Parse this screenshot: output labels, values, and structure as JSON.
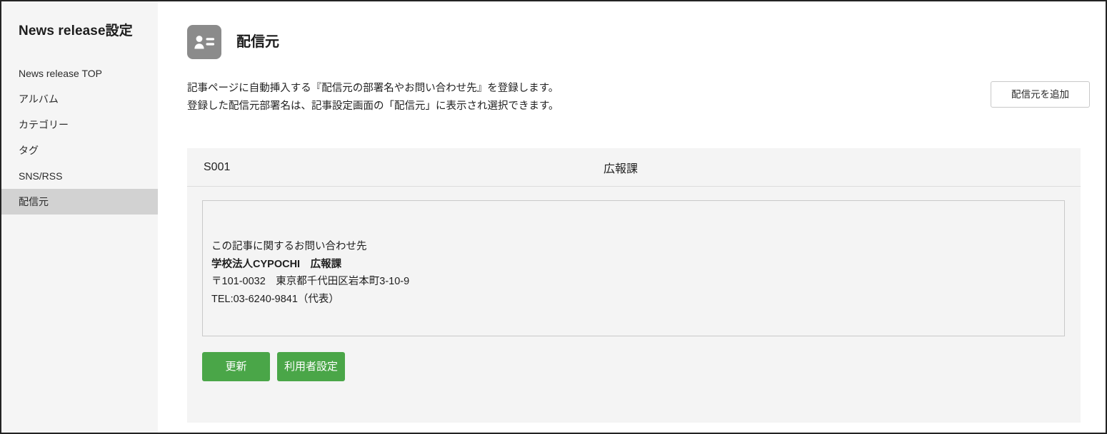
{
  "sidebar": {
    "title": "News release設定",
    "items": [
      {
        "label": "News release TOP",
        "active": false
      },
      {
        "label": "アルバム",
        "active": false
      },
      {
        "label": "カテゴリー",
        "active": false
      },
      {
        "label": "タグ",
        "active": false
      },
      {
        "label": "SNS/RSS",
        "active": false
      },
      {
        "label": "配信元",
        "active": true
      }
    ]
  },
  "header": {
    "icon": "contact-card-icon",
    "title": "配信元"
  },
  "description": {
    "line1": "記事ページに自動挿入する『配信元の部署名やお問い合わせ先』を登録します。",
    "line2": "登録した配信元部署名は、記事設定画面の「配信元」に表示され選択できます。"
  },
  "actions": {
    "add_label": "配信元を追加",
    "update_label": "更新",
    "user_settings_label": "利用者設定"
  },
  "record": {
    "id": "S001",
    "department": "広報課",
    "content_lines": [
      {
        "text": "この記事に関するお問い合わせ先",
        "bold": false
      },
      {
        "text": "学校法人CYPOCHI　広報課",
        "bold": true
      },
      {
        "text": "〒101-0032　東京都千代田区岩本町3-10-9",
        "bold": false
      },
      {
        "text": "TEL:03-6240-9841（代表）",
        "bold": false
      }
    ]
  },
  "colors": {
    "accent_green": "#4aa648",
    "sidebar_bg": "#f5f5f5",
    "sidebar_active": "#d2d2d2",
    "panel_bg": "#f4f4f4",
    "icon_gray": "#8b8b8b"
  }
}
